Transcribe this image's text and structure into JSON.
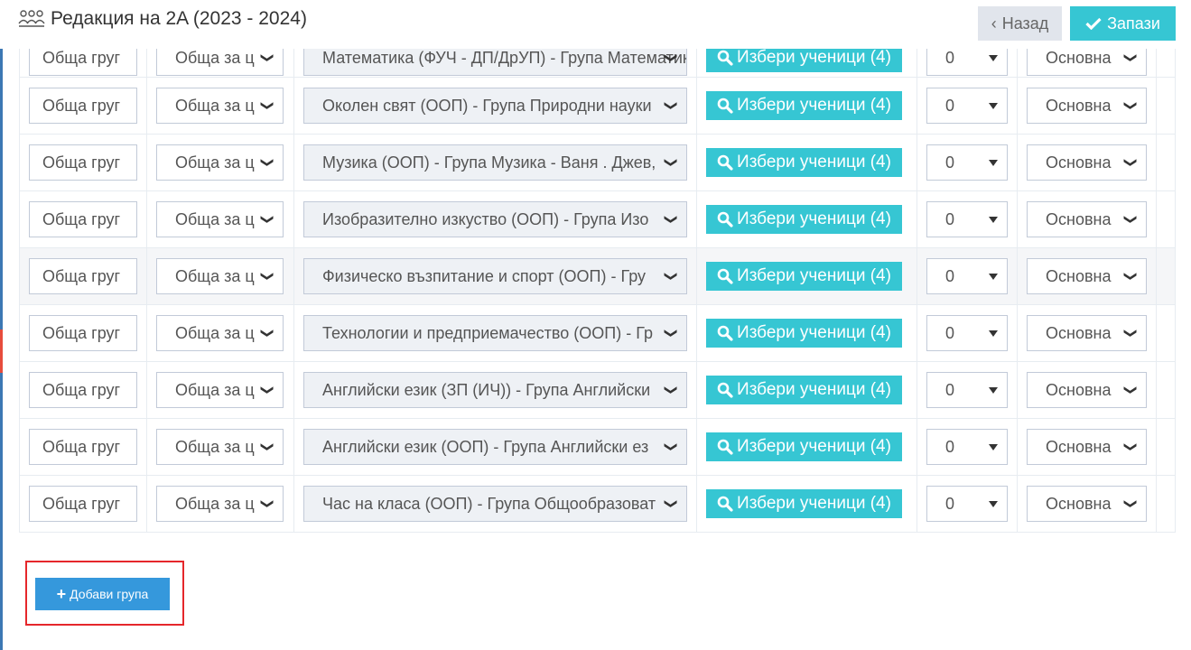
{
  "header": {
    "title": "Редакция на 2A (2023 - 2024)",
    "back_label": "Назад",
    "save_label": "Запази"
  },
  "rows": [
    {
      "group": "Обща груг",
      "type": "Обща за ц",
      "subject": "Математика (ФУЧ - ДП/ДрУП) - Група Математика",
      "students_btn": "Избери ученици (4)",
      "hours": "0",
      "kind": "Основна"
    },
    {
      "group": "Обща груг",
      "type": "Обща за ц",
      "subject": "Околен свят (ООП) - Група Природни науки",
      "students_btn": "Избери ученици (4)",
      "hours": "0",
      "kind": "Основна"
    },
    {
      "group": "Обща груг",
      "type": "Обща за ц",
      "subject": "Музика (ООП) - Група Музика - Ваня . Джев,",
      "students_btn": "Избери ученици (4)",
      "hours": "0",
      "kind": "Основна"
    },
    {
      "group": "Обща груг",
      "type": "Обща за ц",
      "subject": "Изобразително изкуство (ООП) - Група Изо",
      "students_btn": "Избери ученици (4)",
      "hours": "0",
      "kind": "Основна"
    },
    {
      "group": "Обща груг",
      "type": "Обща за ц",
      "subject": "Физическо възпитание и спорт (ООП) - Гру",
      "students_btn": "Избери ученици (4)",
      "hours": "0",
      "kind": "Основна"
    },
    {
      "group": "Обща груг",
      "type": "Обща за ц",
      "subject": "Технологии и предприемачество (ООП) - Гр",
      "students_btn": "Избери ученици (4)",
      "hours": "0",
      "kind": "Основна"
    },
    {
      "group": "Обща груг",
      "type": "Обща за ц",
      "subject": "Английски език (ЗП (ИЧ)) - Група Английски",
      "students_btn": "Избери ученици (4)",
      "hours": "0",
      "kind": "Основна"
    },
    {
      "group": "Обща груг",
      "type": "Обща за ц",
      "subject": "Английски език (ООП) - Група Английски ез",
      "students_btn": "Избери ученици (4)",
      "hours": "0",
      "kind": "Основна"
    },
    {
      "group": "Обща груг",
      "type": "Обща за ц",
      "subject": "Час на класа (ООП) - Група Общообразоват",
      "students_btn": "Избери ученици (4)",
      "hours": "0",
      "kind": "Основна"
    }
  ],
  "add_group_label": "Добави група",
  "colors": {
    "accent": "#36c6d3",
    "primary": "#3598dc",
    "highlight": "#e5272b"
  }
}
